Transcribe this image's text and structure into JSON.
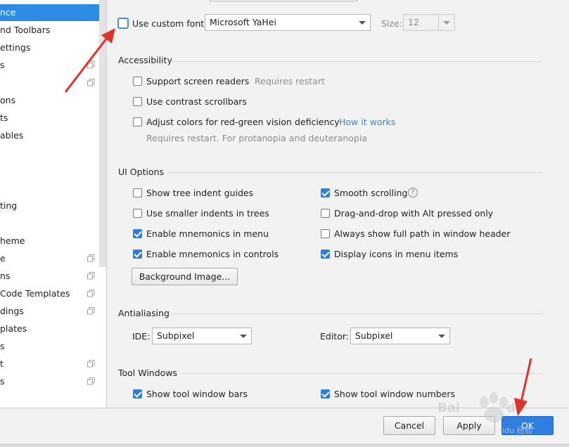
{
  "sidebar": {
    "items": [
      {
        "label": "nce",
        "selected": true
      },
      {
        "label": "nd Toolbars"
      },
      {
        "label": "ettings"
      },
      {
        "label": "s"
      },
      {
        "label": ""
      },
      {
        "label": "ons"
      },
      {
        "label": "ts"
      },
      {
        "label": "ables"
      },
      {
        "label": ""
      },
      {
        "label": ""
      },
      {
        "label": ""
      },
      {
        "label": "ting"
      },
      {
        "label": ""
      },
      {
        "label": ""
      },
      {
        "label": "heme"
      },
      {
        "label": "e"
      },
      {
        "label": "ns"
      },
      {
        "label": "Code Templates"
      },
      {
        "label": "dings"
      },
      {
        "label": "plates"
      },
      {
        "label": "s"
      },
      {
        "label": "t"
      },
      {
        "label": "s"
      }
    ]
  },
  "font": {
    "use_custom_font_label": "Use custom font:",
    "font_value": "Microsoft YaHei",
    "size_label": "Size:",
    "size_value": "12"
  },
  "accessibility": {
    "title": "Accessibility",
    "screen_readers_label": "Support screen readers",
    "screen_readers_hint": "Requires restart",
    "contrast_scrollbars_label": "Use contrast scrollbars",
    "red_green_label": "Adjust colors for red-green vision deficiency",
    "how_it_works_link": "How it works",
    "red_green_hint": "Requires restart. For protanopia and deuteranopia"
  },
  "ui_options": {
    "title": "UI Options",
    "tree_indent_guides": "Show tree indent guides",
    "smaller_indents": "Use smaller indents in trees",
    "mnemonics_menu": "Enable mnemonics in menu",
    "mnemonics_controls": "Enable mnemonics in controls",
    "smooth_scrolling": "Smooth scrolling",
    "drag_and_drop": "Drag-and-drop with Alt pressed only",
    "full_path": "Always show full path in window header",
    "display_icons": "Display icons in menu items",
    "background_image_button": "Background Image...",
    "help_glyph": "?"
  },
  "antialiasing": {
    "title": "Antialiasing",
    "ide_label": "IDE:",
    "ide_value": "Subpixel",
    "editor_label": "Editor:",
    "editor_value": "Subpixel"
  },
  "tool_windows": {
    "title": "Tool Windows",
    "show_bars": "Show tool window bars",
    "show_numbers": "Show tool window numbers"
  },
  "footer": {
    "cancel_label": "Cancel",
    "apply_label": "Apply",
    "ok_label": "OK"
  },
  "watermark": {
    "text": "Baidu 经验"
  },
  "colors": {
    "accent": "#2d8de6",
    "annotation_arrow": "#e0322c",
    "link": "#3c85d6"
  }
}
